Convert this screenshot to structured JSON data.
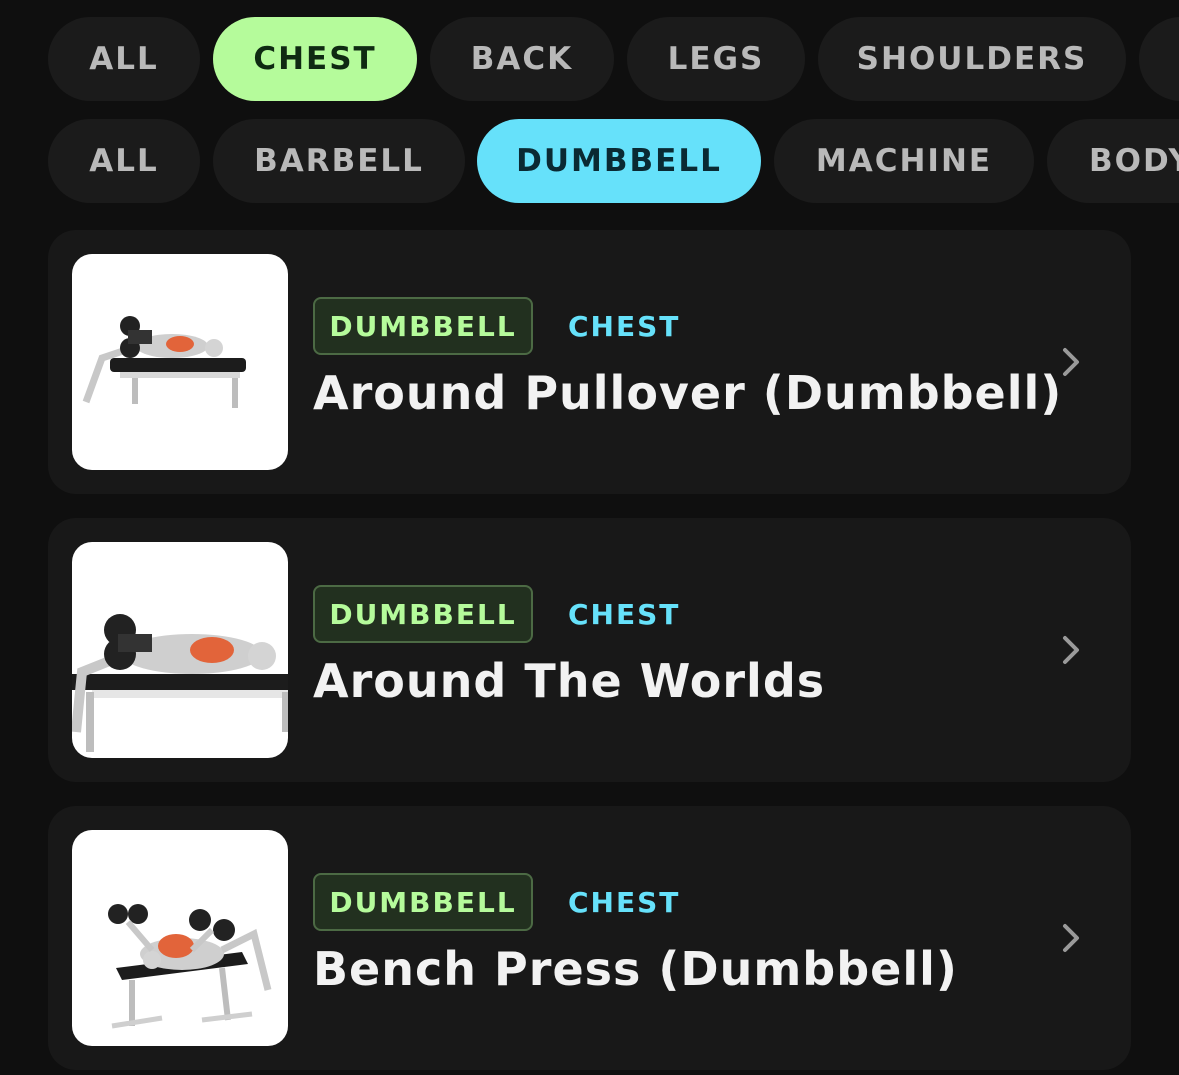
{
  "muscle_filters": [
    {
      "label": "ALL",
      "active": false
    },
    {
      "label": "CHEST",
      "active": true
    },
    {
      "label": "BACK",
      "active": false
    },
    {
      "label": "LEGS",
      "active": false
    },
    {
      "label": "SHOULDERS",
      "active": false
    }
  ],
  "equipment_filters": [
    {
      "label": "ALL",
      "active": false
    },
    {
      "label": "BARBELL",
      "active": false
    },
    {
      "label": "DUMBBELL",
      "active": true
    },
    {
      "label": "MACHINE",
      "active": false
    },
    {
      "label": "BODY",
      "active": false
    }
  ],
  "exercises": [
    {
      "equipment": "DUMBBELL",
      "muscle": "CHEST",
      "name": "Around Pullover (Dumbbell)",
      "icon": "chevron-right-icon"
    },
    {
      "equipment": "DUMBBELL",
      "muscle": "CHEST",
      "name": "Around The Worlds",
      "icon": "chevron-right-icon"
    },
    {
      "equipment": "DUMBBELL",
      "muscle": "CHEST",
      "name": "Bench Press (Dumbbell)",
      "icon": "chevron-right-icon"
    }
  ],
  "colors": {
    "background": "#0f0f0f",
    "chip": "#1b1b1b",
    "muscle_accent": "#b5fb9b",
    "equipment_accent": "#66e1fa",
    "card": "#181818"
  }
}
